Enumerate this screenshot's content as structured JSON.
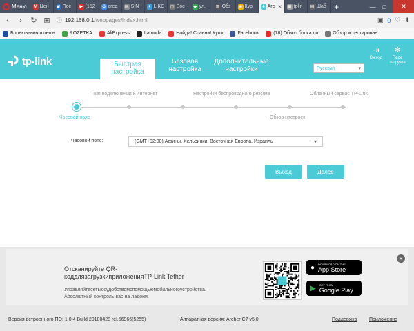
{
  "browser": {
    "menu_label": "Меню",
    "tabs": [
      {
        "label": "Цен",
        "color": "#d03b2f",
        "glyph": "M"
      },
      {
        "label": "Пос",
        "color": "#2b6cb0",
        "glyph": "▣"
      },
      {
        "label": "(152",
        "color": "#e52d27",
        "glyph": "▶"
      },
      {
        "label": "crea",
        "color": "#4285f4",
        "glyph": "G"
      },
      {
        "label": "SIN",
        "color": "#888888",
        "glyph": "▤"
      },
      {
        "label": "LIKC",
        "color": "#3b9bd8",
        "glyph": "+"
      },
      {
        "label": "Бое",
        "color": "#777777",
        "glyph": "▢"
      },
      {
        "label": "ул.",
        "color": "#34a853",
        "glyph": "◆"
      },
      {
        "label": "Обз",
        "color": "#555555",
        "glyph": "▥"
      },
      {
        "label": "Кур",
        "color": "#f4b400",
        "glyph": "◉"
      },
      {
        "label": "Arc",
        "color": "#4acbd6",
        "glyph": "✚",
        "active": true
      },
      {
        "label": "tplin",
        "color": "#999999",
        "glyph": "▦"
      },
      {
        "label": "Шаб",
        "color": "#666666",
        "glyph": "▤"
      }
    ],
    "url_host": "192.168.0.1",
    "url_path": "/webpages/index.html",
    "badge_count": "0",
    "bookmarks": [
      {
        "label": "Бронювання готелів",
        "color": "#1a4fa0"
      },
      {
        "label": "ROZETKA",
        "color": "#43a047"
      },
      {
        "label": "AliExpress",
        "color": "#e53935"
      },
      {
        "label": "Lamoda",
        "color": "#222222"
      },
      {
        "label": "Найди! Сравни! Купи",
        "color": "#e53935"
      },
      {
        "label": "Facebook",
        "color": "#3b5998"
      },
      {
        "label": "(78) Обзор блока пи",
        "color": "#e52d27"
      },
      {
        "label": "Обзор и тестирован",
        "color": "#777777"
      }
    ]
  },
  "header": {
    "logo_text": "tp-link",
    "nav": [
      {
        "label": "Быстрая настройка",
        "active": true
      },
      {
        "label": "Базовая настройка",
        "active": false
      },
      {
        "label": "Дополнительные настройки",
        "active": false
      }
    ],
    "language": "Русский",
    "exit_label": "Выход",
    "reboot_label": "Пере загрузка"
  },
  "wizard": {
    "steps": [
      {
        "label": "Часовой пояс",
        "active": true
      },
      {
        "label": "Тип подключения к Интернет",
        "active": false
      },
      {
        "label": "",
        "active": false
      },
      {
        "label": "Настройки беспроводного режима",
        "active": false
      },
      {
        "label": "",
        "active": false
      },
      {
        "label": "Обзор настроек",
        "active": false
      },
      {
        "label": "Облачный сервис TP-Link",
        "active": false
      }
    ],
    "timezone_label": "Часовой пояс:",
    "timezone_value": "(GMT+02:00) Афины, Хельсинки, Восточная Европа, Израиль",
    "exit_button": "Выход",
    "next_button": "Далее"
  },
  "app_promo": {
    "title": "Отсканируйте QR-коддлязагрузкиприложенияTP-Link Tether",
    "description": "Управляйтесетьюсудобствомспомощьюмобильногоустройства. Абсолютный контроль вас на ладони.",
    "app_store_small": "DOWNLOAD ON THE",
    "app_store_big": "App Store",
    "google_play_small": "GET IT ON",
    "google_play_big": "Google Play"
  },
  "status": {
    "firmware": "Версия встроенного ПО: 1.0.4 Build 20180428 rel.56966(5255)",
    "hardware": "Аппаратная версия: Archer C7 v5.0",
    "support": "Поддержка",
    "app": "Приложение"
  },
  "colors": {
    "brand": "#4acbd6",
    "tabbar": "#4a5363"
  }
}
